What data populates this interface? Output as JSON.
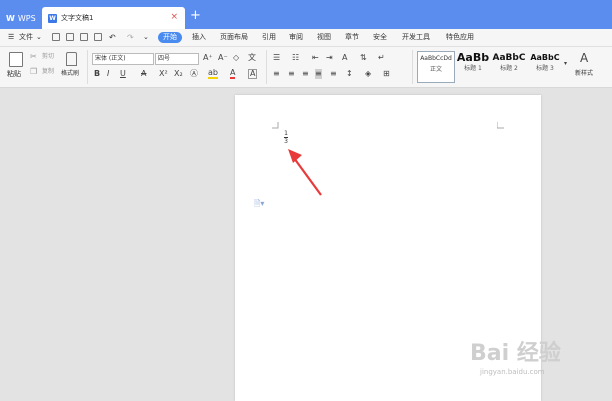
{
  "titlebar": {
    "app_label": "WPS",
    "doc_tab_title": "文字文稿1",
    "close_glyph": "×",
    "new_tab_glyph": "+"
  },
  "menu": {
    "file_label": "文件",
    "items": [
      "开始",
      "插入",
      "页面布局",
      "引用",
      "审阅",
      "视图",
      "章节",
      "安全",
      "开发工具",
      "特色应用"
    ],
    "active_index": 0
  },
  "ribbon": {
    "paste_label": "粘贴",
    "cut_label": "剪切",
    "copy_label": "复制",
    "format_painter_label": "格式刷",
    "font_name": "宋体 (正文)",
    "font_size": "四号",
    "styles": [
      {
        "sample": "AaBbCcDd",
        "name": "正文"
      },
      {
        "sample": "AaBb",
        "name": "标题 1"
      },
      {
        "sample": "AaBbC",
        "name": "标题 2"
      },
      {
        "sample": "AaBbC",
        "name": "标题 3"
      }
    ],
    "new_style_label": "新样式"
  },
  "document": {
    "fraction_numerator": "1",
    "fraction_denominator": "3"
  },
  "watermark": {
    "brand": "Bai 经验",
    "url": "jingyan.baidu.com"
  },
  "colors": {
    "titlebar": "#5b8def",
    "active_menu": "#4a8bf0",
    "arrow": "#e83a3a"
  }
}
